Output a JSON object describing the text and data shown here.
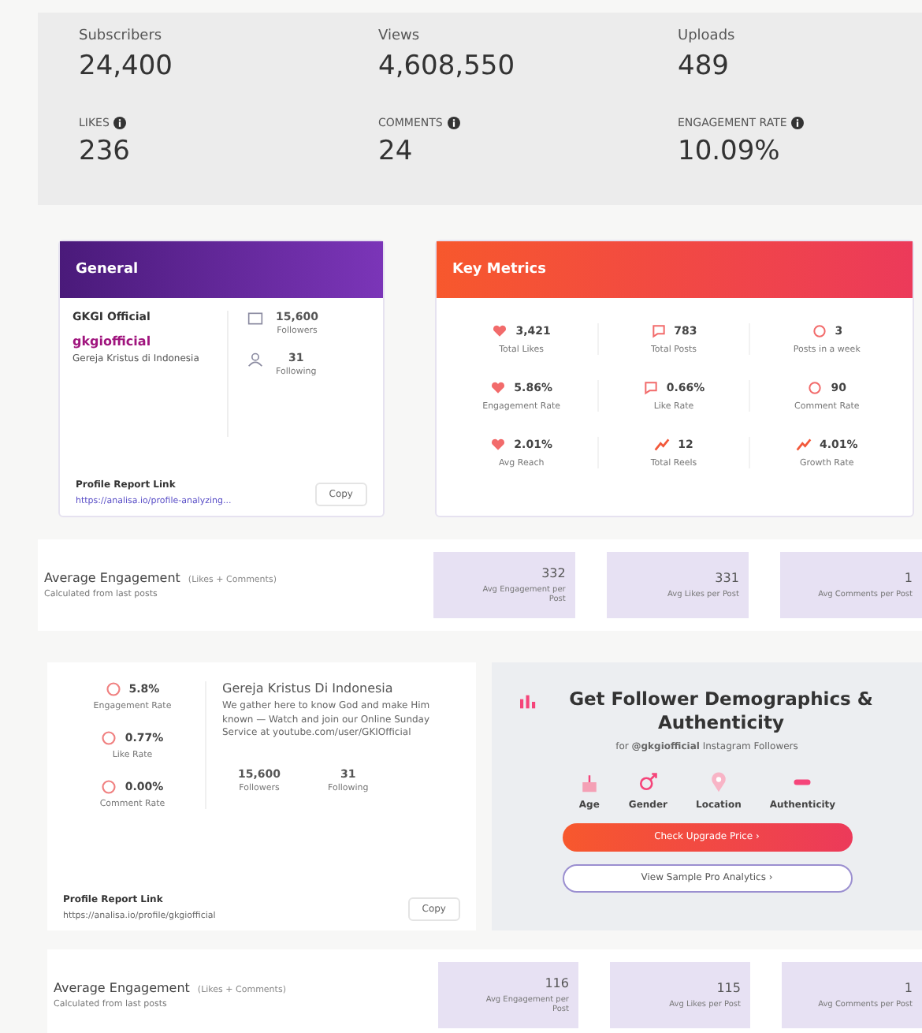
{
  "stats": [
    {
      "label": "Subscribers",
      "value": "24,400",
      "info": false
    },
    {
      "label": "Views",
      "value": "4,608,550",
      "info": false
    },
    {
      "label": "Uploads",
      "value": "489",
      "info": false
    },
    {
      "label": "LIKES",
      "value": "236",
      "info": true
    },
    {
      "label": "COMMENTS",
      "value": "24",
      "info": true
    },
    {
      "label": "ENGAGEMENT RATE",
      "value": "10.09%",
      "info": true
    }
  ],
  "general": {
    "title": "General",
    "account": "GKGI Official",
    "handle": "gkgiofficial",
    "name": "Gereja Kristus di Indonesia",
    "followers_value": "15,600",
    "followers_label": "Followers",
    "following_value": "31",
    "following_label": "Following",
    "report_label": "Profile Report Link",
    "report_url": "https://analisa.io/profile-analyzing...",
    "copy_label": "Copy"
  },
  "key_metrics": {
    "title": "Key Metrics",
    "items": [
      {
        "value": "3,421",
        "label": "Total Likes"
      },
      {
        "value": "783",
        "label": "Total Posts"
      },
      {
        "value": "3",
        "label": "Posts in a week"
      },
      {
        "value": "5.86%",
        "label": "Engagement Rate"
      },
      {
        "value": "0.66%",
        "label": "Like Rate"
      },
      {
        "value": "90",
        "label": "Comment Rate"
      },
      {
        "value": "2.01%",
        "label": "Avg Reach"
      },
      {
        "value": "12",
        "label": "Total Reels"
      },
      {
        "value": "4.01%",
        "label": "Growth Rate"
      }
    ]
  },
  "engagement_1": {
    "title": "Average Engagement",
    "formula": "(Likes + Comments)",
    "subtitle": "Calculated from last posts",
    "boxes": [
      {
        "value": "332",
        "label": "Avg Engagement per Post"
      },
      {
        "value": "331",
        "label": "Avg Likes per Post"
      },
      {
        "value": "1",
        "label": "Avg Comments per Post"
      }
    ]
  },
  "profile": {
    "metrics": [
      {
        "value": "5.8%",
        "label": "Engagement Rate"
      },
      {
        "value": "0.77%",
        "label": "Like Rate"
      },
      {
        "value": "0.00%",
        "label": "Comment Rate"
      }
    ],
    "name": "Gereja Kristus Di Indonesia",
    "bio": "We gather here to know God and make Him known — Watch and join our Online Sunday Service at youtube.com/user/GKIOfficial",
    "followers_value": "15,600",
    "followers_label": "Followers",
    "following_value": "31",
    "following_label": "Following",
    "report_label": "Profile Report Link",
    "report_url": "https://analisa.io/profile/gkgiofficial",
    "copy_label": "Copy"
  },
  "promo": {
    "title": "Get Follower Demographics & Authenticity",
    "subtitle": "for **@gkgiofficial** Instagram Followers",
    "features": [
      {
        "kind": "age",
        "label": "Age"
      },
      {
        "kind": "gender",
        "label": "Gender"
      },
      {
        "kind": "location",
        "label": "Location"
      },
      {
        "kind": "authenticity",
        "label": "Authenticity"
      }
    ],
    "primary": "Check Upgrade Price ›",
    "secondary": "View Sample Pro Analytics ›"
  },
  "engagement_2": {
    "title": "Average Engagement",
    "formula": "(Likes + Comments)",
    "subtitle": "Calculated from last posts",
    "boxes": [
      {
        "value": "116",
        "label": "Avg Engagement per Post"
      },
      {
        "value": "115",
        "label": "Avg Likes per Post"
      },
      {
        "value": "1",
        "label": "Avg Comments per Post"
      }
    ]
  }
}
